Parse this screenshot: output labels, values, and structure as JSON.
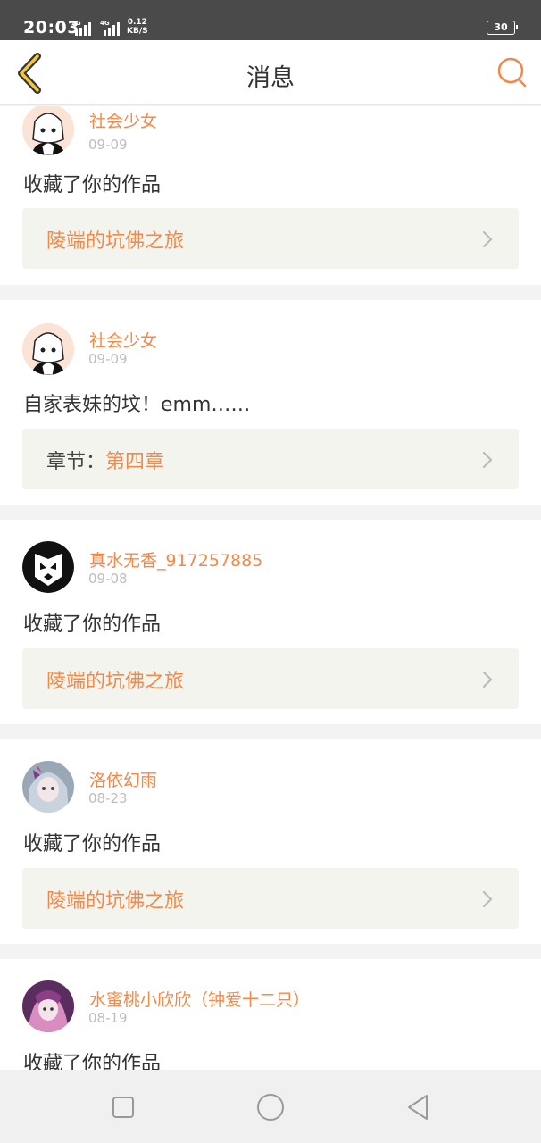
{
  "status_bar": {
    "time": "20:03",
    "signal_1": "2G",
    "signal_2": "4G",
    "speed_value": "0.12",
    "speed_unit": "KB/S",
    "battery": "30"
  },
  "header": {
    "title": "消息",
    "back_icon": "chevron-left-icon",
    "search_icon": "search-icon",
    "accent_color": "#f08a4b"
  },
  "messages": [
    {
      "user": "社会少女",
      "date": "09-09",
      "text": "收藏了你的作品",
      "link_prefix": "",
      "link": "陵端的坑佛之旅"
    },
    {
      "user": "社会少女",
      "date": "09-09",
      "text": "自家表妹的坟！emm……",
      "link_prefix": "章节：",
      "link": "第四章"
    },
    {
      "user": "真水无香_917257885",
      "date": "09-08",
      "text": "收藏了你的作品",
      "link_prefix": "",
      "link": "陵端的坑佛之旅"
    },
    {
      "user": "洛依幻雨",
      "date": "08-23",
      "text": "收藏了你的作品",
      "link_prefix": "",
      "link": "陵端的坑佛之旅"
    },
    {
      "user": "水蜜桃小欣欣（钟爱十二只）",
      "date": "08-19",
      "text": "收藏了你的作品"
    }
  ],
  "nav_bar": {
    "icons": [
      "square-icon",
      "circle-icon",
      "triangle-back-icon"
    ]
  }
}
